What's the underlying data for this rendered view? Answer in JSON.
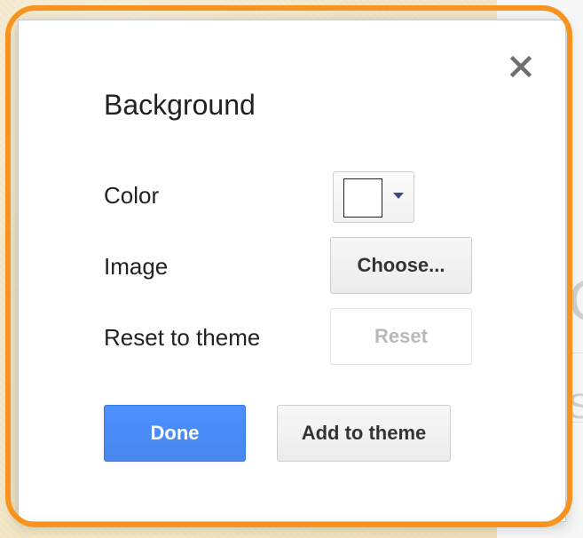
{
  "dialog": {
    "title": "Background",
    "close_icon": "close-icon"
  },
  "rows": {
    "color": {
      "label": "Color",
      "selected_color": "#ffffff",
      "dropdown_icon": "chevron-down-icon"
    },
    "image": {
      "label": "Image",
      "button_label": "Choose..."
    },
    "reset": {
      "label": "Reset to theme",
      "button_label": "Reset"
    }
  },
  "footer": {
    "done_label": "Done",
    "add_to_theme_label": "Add to theme"
  },
  "behind": {
    "glyph_large": "C",
    "glyph_small": "S"
  },
  "colors": {
    "accent_blue": "#4d90fe",
    "highlight_orange": "#f7931e"
  }
}
